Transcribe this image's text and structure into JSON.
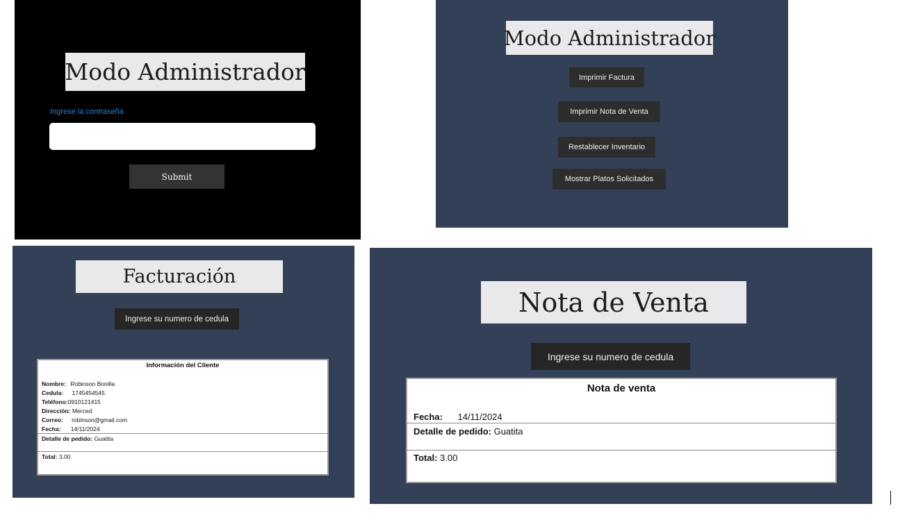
{
  "login": {
    "title": "Modo Administrador",
    "password_label": "Ingrese la contraseña",
    "password_value": "",
    "submit_label": "Submit"
  },
  "admin_menu": {
    "title": "Modo Administrador",
    "buttons": [
      "Imprimir Factura",
      "Imprimir Nota de Venta",
      "Restablecer Inventario",
      "Mostrar Platos Solicitados"
    ]
  },
  "facturacion": {
    "title": "Facturación",
    "cedula_button": "Ingrese su numero de cedula",
    "card": {
      "heading": "Información del Cliente",
      "fields": [
        {
          "label": "Nombre:",
          "value": "Robinson Bonilla"
        },
        {
          "label": "Cedula:",
          "value": "1745454545"
        },
        {
          "label": "Teléfono:",
          "value": "0910121415"
        },
        {
          "label": "Dirección:",
          "value": "Merced"
        },
        {
          "label": "Correo:",
          "value": "robinson@gmail.com"
        },
        {
          "label": "Fecha:",
          "value": "14/11/2024"
        }
      ],
      "detalle_label": "Detalle de pedido:",
      "detalle_value": "Guatita",
      "total_label": "Total:",
      "total_value": "3.00"
    }
  },
  "nota_venta": {
    "title": "Nota de Venta",
    "cedula_button": "Ingrese su numero de cedula",
    "card": {
      "heading": "Nota de venta",
      "fecha_label": "Fecha:",
      "fecha_value": "14/11/2024",
      "detalle_label": "Detalle de pedido:",
      "detalle_value": "Guatita",
      "total_label": "Total:",
      "total_value": "3.00"
    }
  },
  "colors": {
    "navy_panel": "#334058",
    "black_panel": "#000000",
    "title_box": "#e9e9ec",
    "button_dark": "#262626",
    "label_blue": "#2e80d8"
  }
}
